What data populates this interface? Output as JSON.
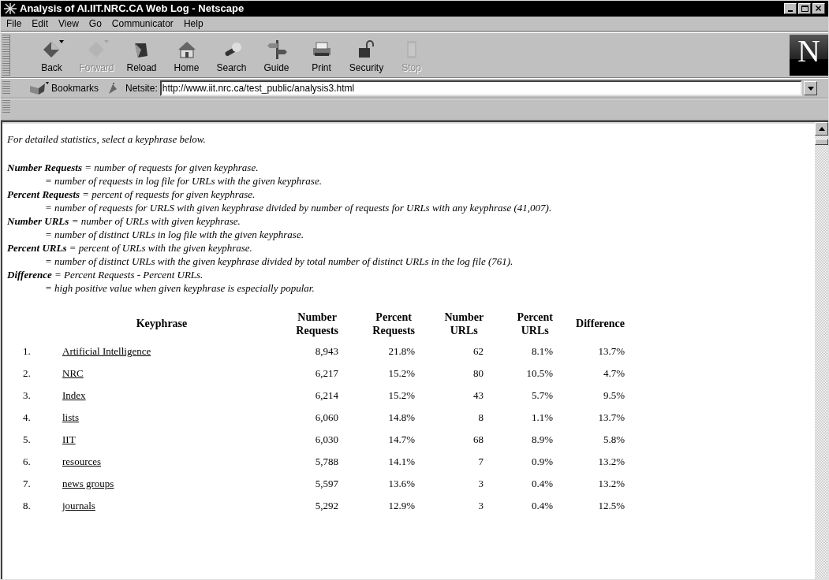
{
  "window": {
    "title": "Analysis of AI.IIT.NRC.CA Web Log - Netscape"
  },
  "menu": [
    "File",
    "Edit",
    "View",
    "Go",
    "Communicator",
    "Help"
  ],
  "toolbar": [
    {
      "label": "Back",
      "kind": "back",
      "disabled": false
    },
    {
      "label": "Forward",
      "kind": "forward",
      "disabled": true
    },
    {
      "label": "Reload",
      "kind": "reload",
      "disabled": false
    },
    {
      "label": "Home",
      "kind": "home",
      "disabled": false
    },
    {
      "label": "Search",
      "kind": "search",
      "disabled": false
    },
    {
      "label": "Guide",
      "kind": "guide",
      "disabled": false
    },
    {
      "label": "Print",
      "kind": "print",
      "disabled": false
    },
    {
      "label": "Security",
      "kind": "security",
      "disabled": false
    },
    {
      "label": "Stop",
      "kind": "stop",
      "disabled": true
    }
  ],
  "logo": "N",
  "location": {
    "bookmarks": "Bookmarks",
    "label": "Netsite:",
    "url": "http://www.iit.nrc.ca/test_public/analysis3.html"
  },
  "intro": "For detailed statistics, select a keyphrase below.",
  "definitions": [
    {
      "term": "**Number Requests** = number of requests for given keyphrase.",
      "detail": "= number of requests in log file for URLs with the given keyphrase."
    },
    {
      "term": "**Percent Requests** = percent of requests for given keyphrase.",
      "detail": "= number of requests for URLS with given keyphrase divided by number of requests for URLs with any keyphrase (41,007)."
    },
    {
      "term": "**Number URLs** = number of URLs with given keyphrase.",
      "detail": "= number of distinct URLs in log file with the given keyphrase."
    },
    {
      "term": "**Percent URLs** = percent of URLs with the given keyphrase.",
      "detail": "= number of distinct URLs with the given keyphrase divided by total number of distinct URLs in the log file (761)."
    },
    {
      "term": "**Difference** = Percent Requests - Percent URLs.",
      "detail": "= high positive value when given keyphrase is especially popular."
    }
  ],
  "table": {
    "columns": [
      "",
      "Keyphrase",
      "Number Requests",
      "Percent Requests",
      "Number URLs",
      "Percent URLs",
      "Difference"
    ],
    "rows": [
      [
        "1.",
        "Artificial Intelligence",
        "8,943",
        "21.8%",
        "62",
        "8.1%",
        "13.7%"
      ],
      [
        "2.",
        "NRC",
        "6,217",
        "15.2%",
        "80",
        "10.5%",
        "4.7%"
      ],
      [
        "3.",
        "Index",
        "6,214",
        "15.2%",
        "43",
        "5.7%",
        "9.5%"
      ],
      [
        "4.",
        "lists",
        "6,060",
        "14.8%",
        "8",
        "1.1%",
        "13.7%"
      ],
      [
        "5.",
        "IIT",
        "6,030",
        "14.7%",
        "68",
        "8.9%",
        "5.8%"
      ],
      [
        "6.",
        "resources",
        "5,788",
        "14.1%",
        "7",
        "0.9%",
        "13.2%"
      ],
      [
        "7.",
        "news groups",
        "5,597",
        "13.6%",
        "3",
        "0.4%",
        "13.2%"
      ],
      [
        "8.",
        "journals",
        "5,292",
        "12.9%",
        "3",
        "0.4%",
        "12.5%"
      ]
    ]
  }
}
